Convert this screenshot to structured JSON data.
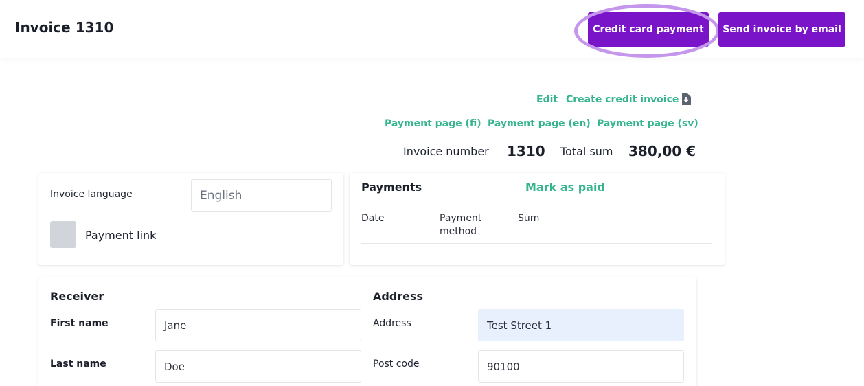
{
  "header": {
    "title": "Invoice 1310",
    "credit_card_button": "Credit card payment",
    "send_email_button": "Send invoice by email"
  },
  "actions": {
    "edit": "Edit",
    "create_credit_invoice": "Create credit invoice",
    "payment_page_fi": "Payment page (fi)",
    "payment_page_en": "Payment page (en)",
    "payment_page_sv": "Payment page (sv)"
  },
  "summary": {
    "invoice_number_label": "Invoice number",
    "invoice_number": "1310",
    "total_sum_label": "Total sum",
    "total_sum": "380,00 €"
  },
  "settings": {
    "invoice_language_label": "Invoice language",
    "invoice_language_value": "English",
    "payment_link_label": "Payment link"
  },
  "payments": {
    "heading": "Payments",
    "mark_as_paid": "Mark as paid",
    "columns": [
      "Date",
      "Payment method",
      "Sum"
    ]
  },
  "receiver": {
    "heading": "Receiver",
    "first_name_label": "First name",
    "first_name": "Jane",
    "last_name_label": "Last name",
    "last_name": "Doe"
  },
  "address": {
    "heading": "Address",
    "address_label": "Address",
    "address": "Test Street 1",
    "post_code_label": "Post code",
    "post_code": "90100"
  },
  "colors": {
    "accent_purple": "#7a14c8",
    "link_green": "#35b48f",
    "highlight_ring": "#c597ec"
  },
  "icons": {
    "credit_invoice": "download-document-icon"
  }
}
